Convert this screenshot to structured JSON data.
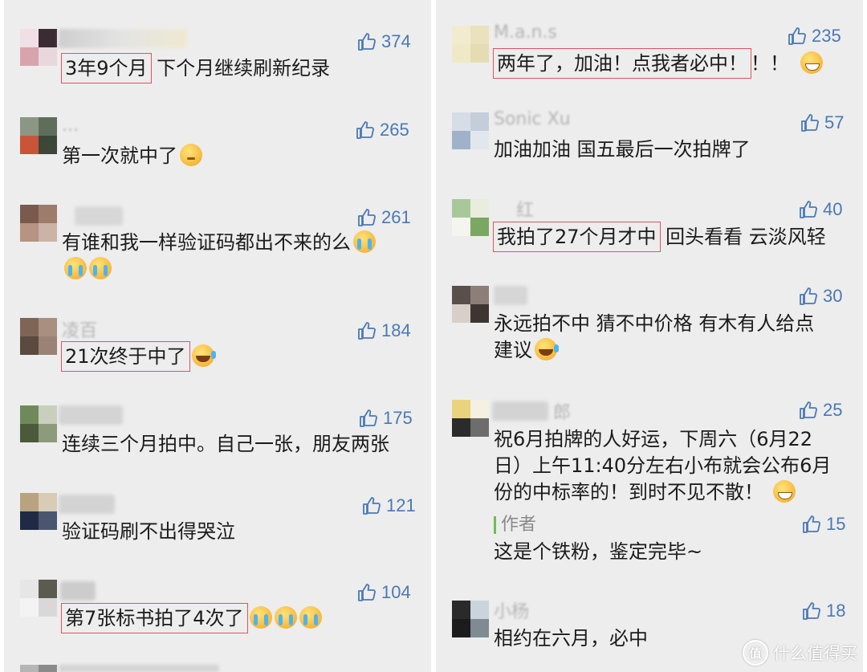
{
  "left_comments": [
    {
      "likes": "374",
      "text": [
        "3年9个月",
        " 下个月继续刷新纪录"
      ]
    },
    {
      "likes": "265",
      "text": [
        "第一次就中了"
      ]
    },
    {
      "likes": "261",
      "text": [
        "有谁和我一样验证码都出不来的么"
      ]
    },
    {
      "likes": "184",
      "name": "凌百",
      "text": [
        "21次终于中了"
      ]
    },
    {
      "likes": "175",
      "text": [
        "连续三个月拍中。自己一张，朋友两张"
      ]
    },
    {
      "likes": "121",
      "text": [
        "验证码刷不出得哭泣"
      ]
    },
    {
      "likes": "104",
      "text": [
        "第7张标书拍了4次了"
      ]
    }
  ],
  "right_comments": [
    {
      "likes": "235",
      "name": "M.a.n.s",
      "text": [
        "两年了，加油！点我者必中！",
        "！！"
      ]
    },
    {
      "likes": "57",
      "name": "Sonic Xu",
      "text": [
        "加油加油 国五最后一次拍牌了"
      ]
    },
    {
      "likes": "40",
      "name": "红",
      "text": [
        "我拍了27个月才中",
        " 回头看看 云淡风轻"
      ]
    },
    {
      "likes": "30",
      "text": [
        "永远拍不中 猜不中价格 有木有人给点",
        "建议"
      ]
    },
    {
      "likes": "25",
      "name": "郎",
      "text": [
        "祝6月拍牌的人好运，下周六（6月22",
        "日）上午11:40分左右小布就会公布6月",
        "份的中标率的！到时不见不散！"
      ]
    },
    {
      "likes": "15",
      "author_label": "作者",
      "text": [
        "这是个铁粉，鉴定完毕~"
      ]
    },
    {
      "likes": "18",
      "name": "小杨",
      "text": [
        "相约在六月，必中"
      ]
    }
  ],
  "watermark": {
    "logo": "值",
    "text": "什么值得买"
  },
  "colors": {
    "like_blue": "#4a79b4",
    "highlight_red": "#e2525d",
    "panel_bg": "#ededed"
  }
}
